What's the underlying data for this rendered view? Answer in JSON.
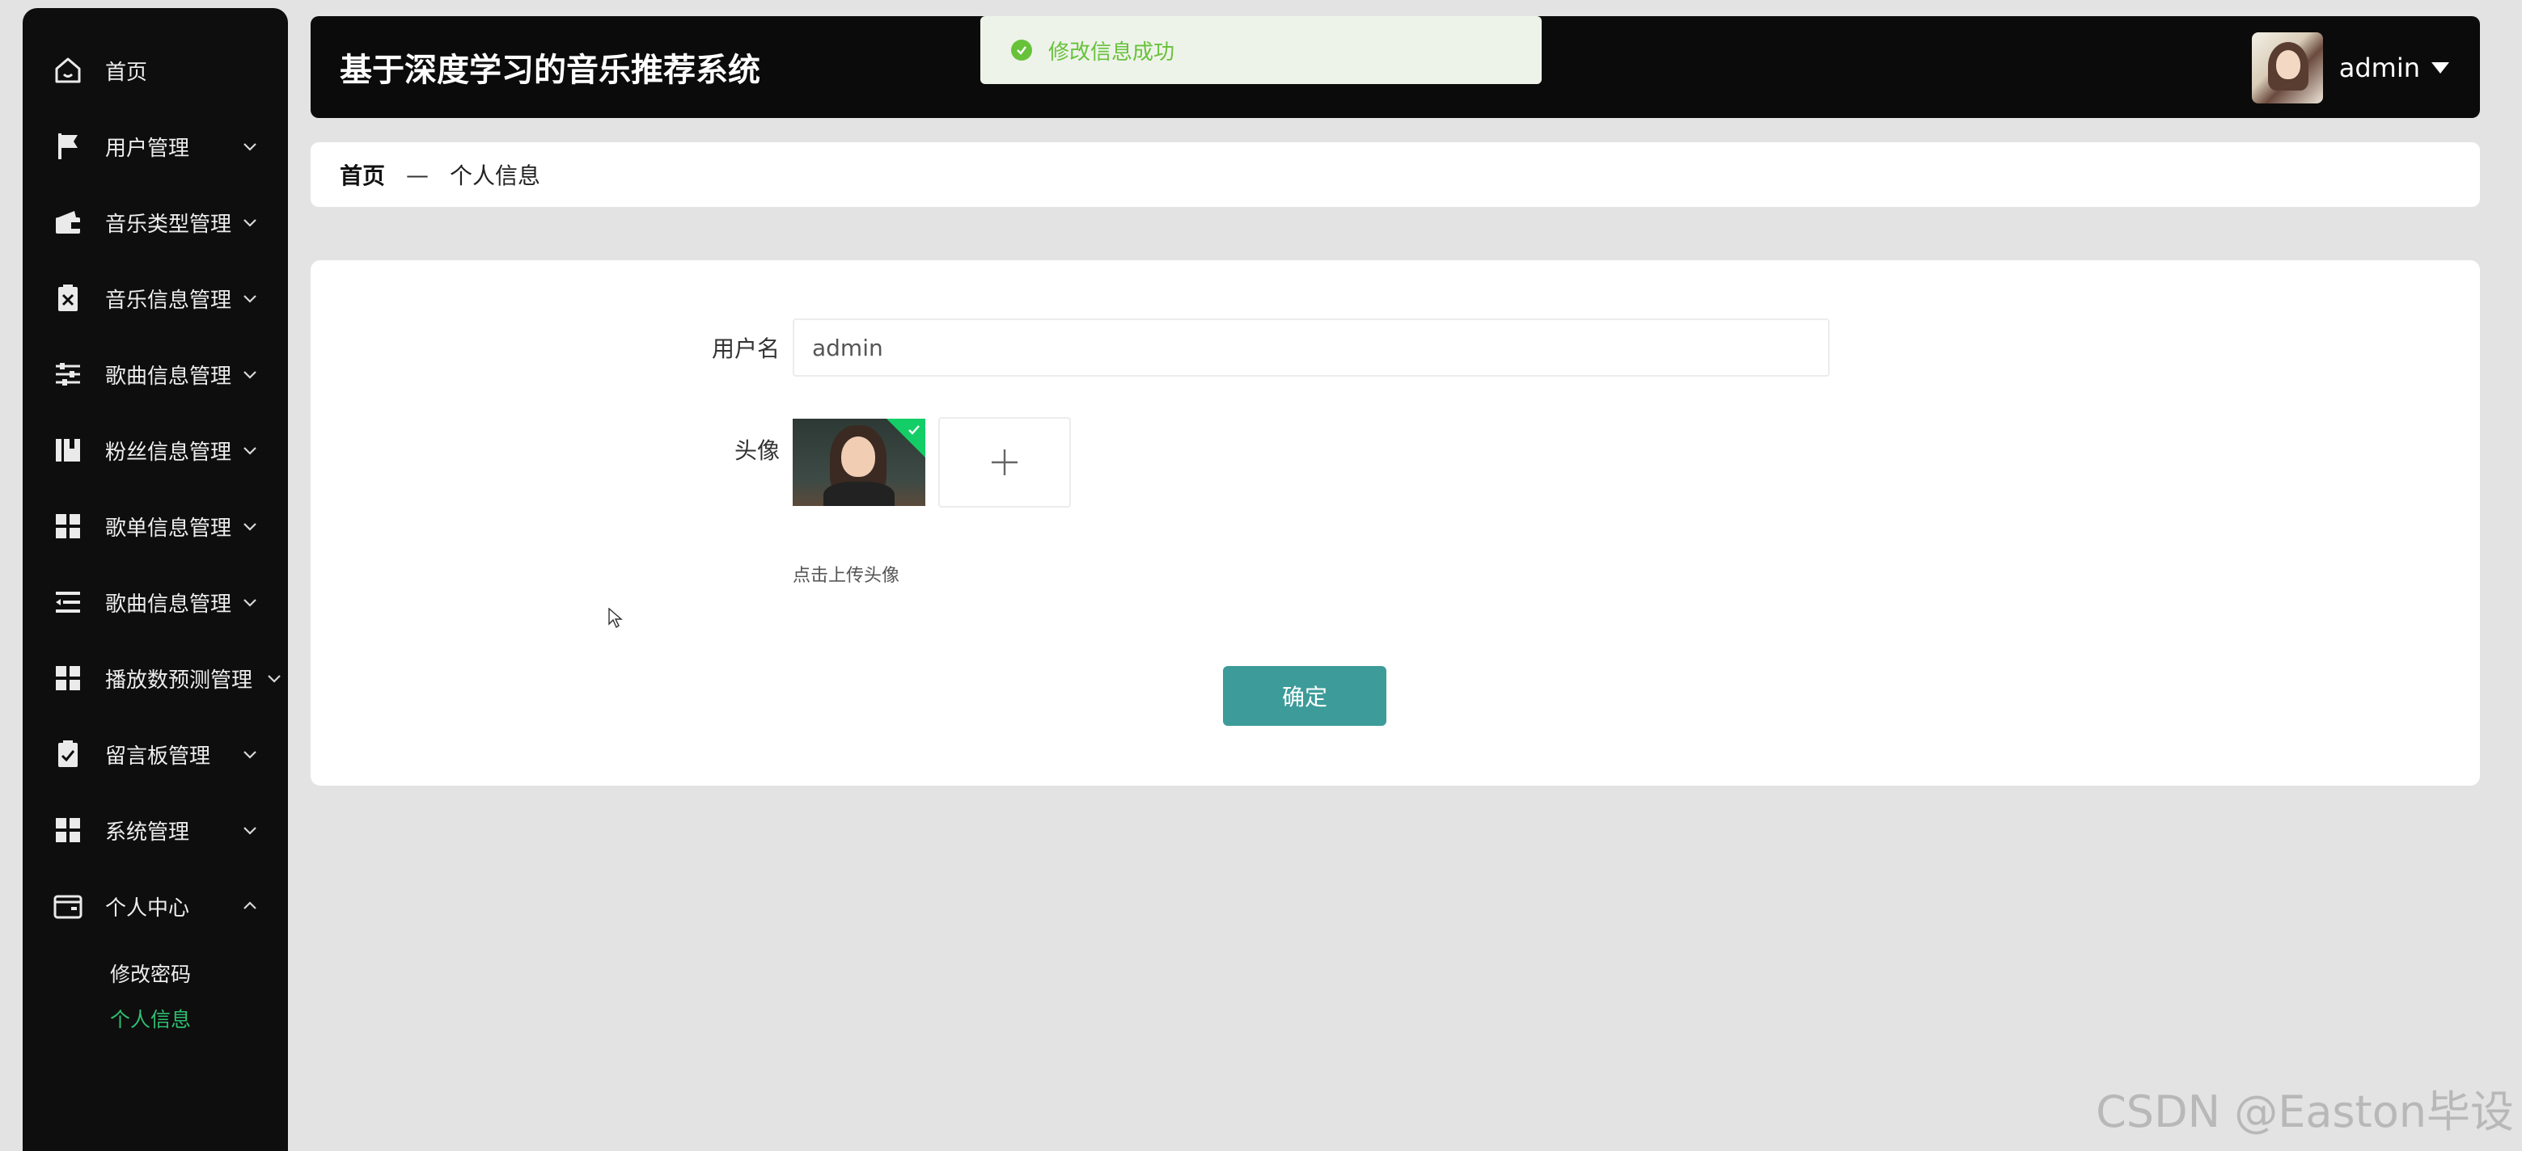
{
  "sidebar": {
    "items": [
      {
        "label": "首页",
        "icon": "home-icon"
      },
      {
        "label": "用户管理",
        "icon": "flag-icon"
      },
      {
        "label": "音乐类型管理",
        "icon": "wallet-icon"
      },
      {
        "label": "音乐信息管理",
        "icon": "clipboard-x-icon"
      },
      {
        "label": "歌曲信息管理",
        "icon": "sliders-icon"
      },
      {
        "label": "粉丝信息管理",
        "icon": "book-icon"
      },
      {
        "label": "歌单信息管理",
        "icon": "grid-icon"
      },
      {
        "label": "歌曲信息管理",
        "icon": "list-icon"
      },
      {
        "label": "播放数预测管理",
        "icon": "grid-icon"
      },
      {
        "label": "留言板管理",
        "icon": "clipboard-check-icon"
      },
      {
        "label": "系统管理",
        "icon": "grid-icon"
      },
      {
        "label": "个人中心",
        "icon": "wallet-icon"
      }
    ],
    "sub_items": [
      {
        "label": "修改密码"
      },
      {
        "label": "个人信息"
      }
    ]
  },
  "header": {
    "title": "基于深度学习的音乐推荐系统",
    "user_name": "admin"
  },
  "toast": {
    "message": "修改信息成功",
    "status_color": "#67c23a"
  },
  "breadcrumb": {
    "home": "首页",
    "separator": "—",
    "current": "个人信息"
  },
  "form": {
    "username_label": "用户名",
    "username_value": "admin",
    "avatar_label": "头像",
    "upload_tip": "点击上传头像",
    "submit_label": "确定"
  },
  "colors": {
    "sidebar_bg": "#0e0e0e",
    "header_bg": "#0b0b0b",
    "active_menu": "#2fbf71",
    "button": "#3d9c9a"
  },
  "watermark": "CSDN @Easton毕设"
}
